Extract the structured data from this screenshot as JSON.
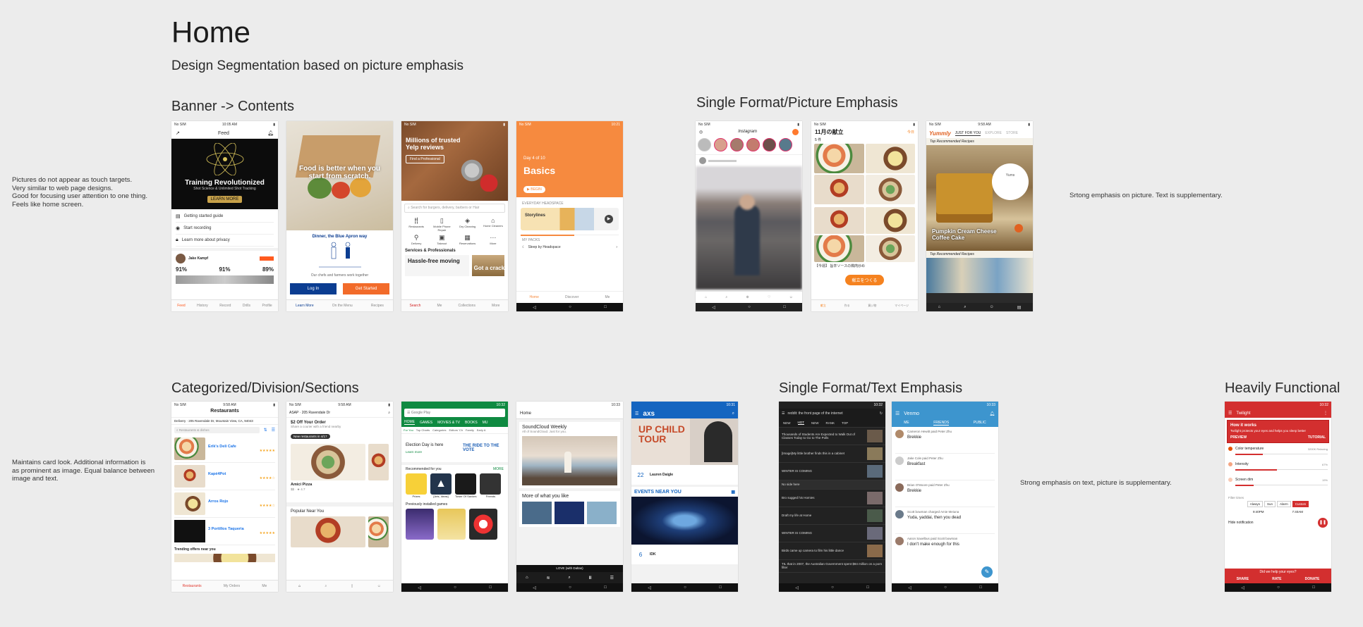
{
  "title": "Home",
  "subtitle": "Design Segmentation based on picture emphasis",
  "sections": {
    "banner": "Banner -> Contents",
    "single_picture": "Single Format/Picture Emphasis",
    "categorized": "Categorized/Division/Sections",
    "single_text": "Single Format/Text Emphasis",
    "functional": "Heavily Functional"
  },
  "notes": {
    "banner": [
      "Pictures do not appear as touch targets.",
      "Very similar to web page designs.",
      "Good for focusing user attention to one thing.",
      "Feels like home screen."
    ],
    "picture": "Srtong emphasis on picture.  Text is supplementary.",
    "categorized": [
      "Maintains card look. Additional information is",
      "as prominent as image.  Equal balance between",
      "image and text."
    ],
    "text": "Strong emphasis on text, picture is supplementary."
  },
  "screens": {
    "feed": {
      "title": "Feed",
      "banner_title": "Training Revolutionized",
      "banner_sub": "Shot Science & Unlimited Shot Tracking",
      "banner_btn": "LEARN MORE",
      "items": [
        "Getting started guide",
        "Start recording",
        "Learn more about privacy"
      ],
      "user": "Jake Kampf",
      "stats": [
        "91%",
        "91%",
        "89%"
      ],
      "tabs": [
        "Feed",
        "History",
        "Record",
        "Drills",
        "Profile"
      ]
    },
    "apron": {
      "hero": "Food is better when you start from scratch.",
      "headline": "Dinner, the Blue Apron way",
      "caption": "Our chefs and farmers work together",
      "login": "Log In",
      "start": "Get Started",
      "tabs": [
        "Learn More",
        "On the Menu",
        "Recipes"
      ]
    },
    "yelp": {
      "hero": "Millions of trusted Yelp reviews",
      "hero_btn": "Find a Professional",
      "search": "Search for burgers, delivery, barbers or Hair",
      "cats": [
        "Restaurants",
        "Mobile Phone Repair",
        "Dry Cleaning",
        "Home Cleaners",
        "Delivery",
        "Takeout",
        "Reservations",
        "More"
      ],
      "section": "Services & Professionals",
      "card1": "Hassle-free moving",
      "card2": "Got a crack",
      "tabs": [
        "Search",
        "Me",
        "Collections",
        "More"
      ]
    },
    "headspace": {
      "day": "Day 4 of 10",
      "title": "Basics",
      "begin": "BEGIN",
      "everyday": "EVERYDAY HEADSPACE",
      "storylines": "Storylines",
      "packs": "MY PACKS",
      "sleep": "Sleep by Headspace",
      "tabs": [
        "Home",
        "Discover",
        "Me"
      ]
    },
    "instagram": {
      "title": "Instagram"
    },
    "kondate": {
      "title": "11月の献立",
      "action": "今日",
      "count": "5 件",
      "caption": "【今週】 旨辛ソースの鶏肉炒め",
      "button": "献立をつくる",
      "tabs": [
        "献立",
        "作る",
        "買い物",
        "マイページ"
      ]
    },
    "yummly": {
      "logo": "Yummly",
      "tabs": [
        "JUST FOR YOU",
        "EXPLORE",
        "STORE"
      ],
      "tag": "Top Recommended Recipes",
      "bubble": "Yums",
      "recipe": "Pumpkin Cream Cheese Coffee Cake",
      "tag2": "Top Recommended Recipes"
    },
    "restaurants": {
      "title": "Restaurants",
      "delivery": "Delivery · 205 Ravendale Dr, Mountain View, CA, 94043",
      "search": "Restaurants & dishes",
      "items": [
        {
          "name": "Erik's Deli Cafe",
          "rating": "★★★★★"
        },
        {
          "name": "Kapé4Pot",
          "rating": "★★★★☆"
        },
        {
          "name": "Arros Rojo",
          "rating": "★★★★☆"
        },
        {
          "name": "3 Portillos Taqueria",
          "rating": "★★★★★"
        }
      ],
      "trending": "Trending offers near you",
      "tabs": [
        "Restaurants",
        "My Orders",
        "Me"
      ]
    },
    "postmates": {
      "address": "ASAP · 205 Ravendale Dr",
      "promo": "$2 Off Your Order",
      "promo_sub": "Share a courier with a friend nearby",
      "badge": "New restaurants in 4/17",
      "rest": "Amici Pizza",
      "popular": "Popular Near You"
    },
    "play": {
      "title": "Google Play",
      "tabs": [
        "HOME",
        "GAMES",
        "MOVIES & TV",
        "BOOKS",
        "MU"
      ],
      "sub": [
        "For You",
        "Top Charts",
        "Categories",
        "Editors' Ch",
        "Family",
        "Early A"
      ],
      "election": "Election Day is here",
      "election_btn": "Learn more",
      "ride": "THE RIDE TO THE VOTE",
      "rec": "Recommended for you",
      "more": "MORE",
      "apps": [
        "Prizes",
        "[Arts, Ideas]",
        "Tower Of Saviors",
        "Friends"
      ],
      "installed": "Previously installed games"
    },
    "soundcloud": {
      "title": "Home",
      "weekly": "SoundCloud Weekly",
      "weekly_sub": "All of SoundCloud. Just for you.",
      "more": "More of what you like",
      "player": "LOVE (with Daltas)"
    },
    "axs": {
      "logo": "axs",
      "hero": "UP CHILD TOUR",
      "date1": "22",
      "artist1": "Lauren Daigle",
      "events": "EVENTS NEAR YOU",
      "date2": "6",
      "artist2": "IDK"
    },
    "reddit": {
      "title": "reddit: the front page of the internet",
      "tabs": [
        "NEW",
        "HOT",
        "NEW",
        "RANK",
        "TOP"
      ],
      "posts": [
        "Thousands of Students Are Expected to Walk Out of Classes Today to Go to The Polls",
        "[Image]My little brother finds this in a cabinet",
        "WINTER IS COMING",
        "No side here",
        "Bro sugged his Homies",
        "Draft my life at Home",
        "WINTER IS COMING",
        "Birds came up camera to film his little dance",
        "TIL that in 2007, the Australian Government spent $84 million on a porn filter"
      ]
    },
    "venmo": {
      "title": "Venmo",
      "tabs": [
        "ME",
        "FRIENDS",
        "PUBLIC"
      ],
      "entries": [
        {
          "who": "Cameron Hewitt paid Peter Zhu",
          "msg": "Brekkie"
        },
        {
          "who": "Jake Cole paid Peter Zhu",
          "msg": "Breakfast"
        },
        {
          "who": "Brian O'Moore paid Peter Zhu",
          "msg": "Brekkie"
        },
        {
          "who": "Scott bowman charged Amie Meiuna",
          "msg": "Yuda, yaddai, then you dead"
        },
        {
          "who": "Aaron Saxelbus paid Scott bowman",
          "msg": "I don't make enough for this"
        }
      ]
    },
    "twilight": {
      "title": "Twilight",
      "how": "How it works",
      "how_sub": "Twilight protects your eyes and helps you sleep better",
      "preview": "PREVIEW",
      "tutorial": "TUTORIAL",
      "sliders": [
        "Color temperature",
        "Intensity",
        "Screen dim"
      ],
      "slider_vals": [
        "3200K Relaxing",
        "67%",
        "19%"
      ],
      "timer": "Filter times",
      "modes": [
        "Always",
        "Sun",
        "Alarm",
        "Custom"
      ],
      "times": [
        "9:40PM",
        "7:40AM"
      ],
      "hide": "Hide notification",
      "help": "Did we help your eyes?",
      "actions": [
        "SHARE",
        "RATE",
        "DONATE"
      ]
    }
  }
}
